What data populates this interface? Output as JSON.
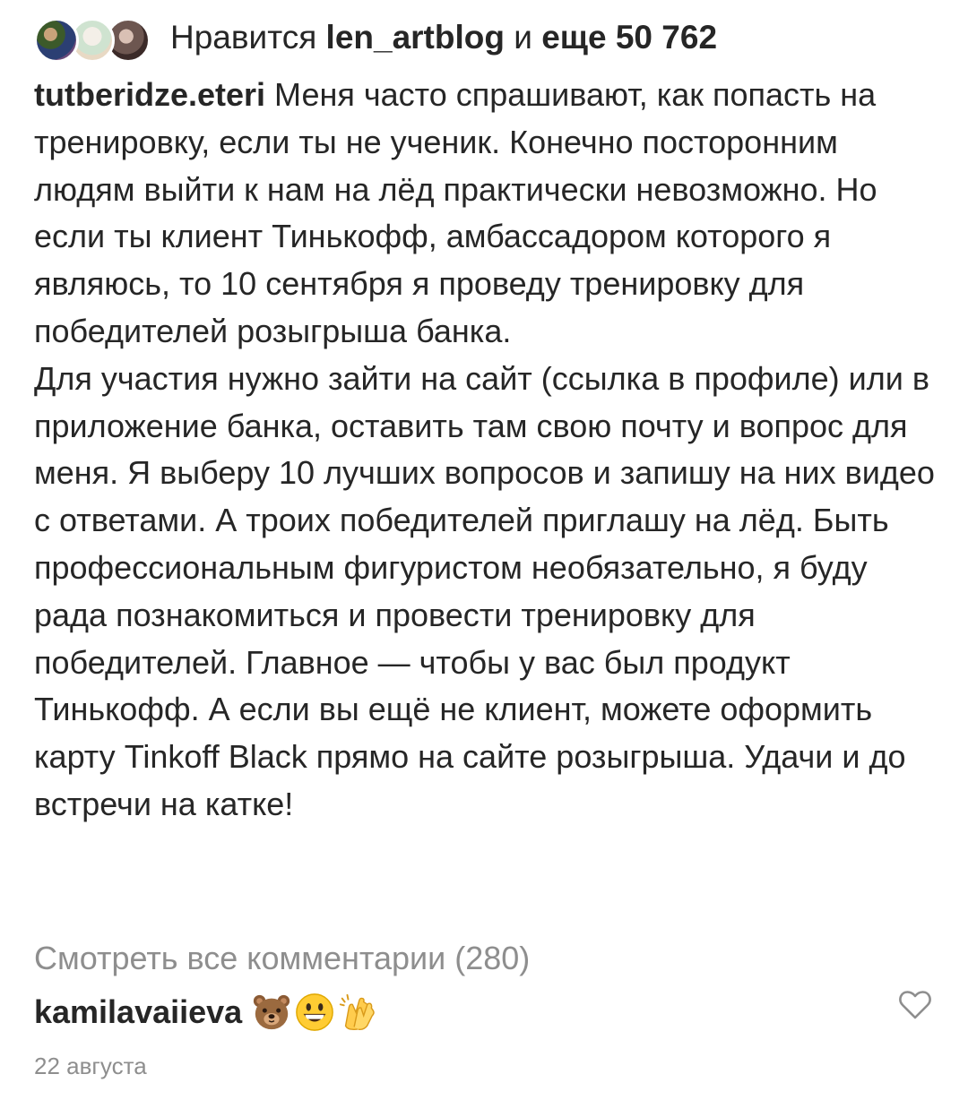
{
  "likes": {
    "prefix": "Нравится ",
    "user": "len_artblog",
    "middle": " и ",
    "count_text": "еще 50 762"
  },
  "caption": {
    "author": "tutberidze.eteri",
    "text": " Меня часто спрашивают, как попасть на тренировку, если ты не ученик. Конечно посторонним людям выйти к нам на лёд практически невозможно. Но если ты клиент Тинькофф, амбассадором которого я являюсь, то 10 сентября я проведу тренировку для победителей розыгрыша банка.\nДля участия нужно зайти на сайт (ссылка в профиле) или в приложение банка, оставить там свою почту и вопрос для меня. Я выберу 10 лучших вопросов и запишу на них видео с ответами. А троих победителей приглашу на лёд. Быть профессиональным фигуристом необязательно, я буду рада познакомиться и провести тренировку для победителей. Главное — чтобы у вас был продукт Тинькофф. А если вы ещё не клиент, можете оформить карту Tinkoff Black прямо на сайте розыгрыша. Удачи и до встречи на катке!"
  },
  "view_all_comments": "Смотреть все комментарии (280)",
  "comment": {
    "user": "kamilavaiieva",
    "emojis": [
      "bear-face-emoji",
      "grinning-face-emoji",
      "clapping-hands-emoji"
    ],
    "date": "22 августа"
  },
  "icons": {
    "like": "heart-outline-icon"
  },
  "colors": {
    "text": "#262626",
    "secondary": "#8e8e8e"
  }
}
